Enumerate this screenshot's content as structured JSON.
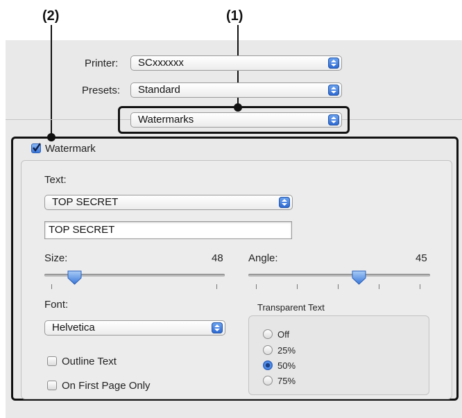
{
  "callouts": {
    "one": "(1)",
    "two": "(2)"
  },
  "printer": {
    "label": "Printer:",
    "value": "SCxxxxxx"
  },
  "presets": {
    "label": "Presets:",
    "value": "Standard"
  },
  "pane_select": {
    "value": "Watermarks"
  },
  "watermark": {
    "checkbox_label": "Watermark",
    "checked": true,
    "text_label": "Text:",
    "text_popup": "TOP SECRET",
    "text_field": "TOP SECRET",
    "size_label": "Size:",
    "size_value": "48",
    "angle_label": "Angle:",
    "angle_value": "45",
    "font_label": "Font:",
    "font_value": "Helvetica",
    "transparent_title": "Transparent Text",
    "transparent_options": [
      "Off",
      "25%",
      "50%",
      "75%"
    ],
    "transparent_selected": "50%",
    "outline_label": "Outline Text",
    "outline_checked": false,
    "first_page_label": "On First Page Only",
    "first_page_checked": false
  },
  "colors": {
    "accent": "#3a77d8",
    "highlight": "#111111"
  }
}
